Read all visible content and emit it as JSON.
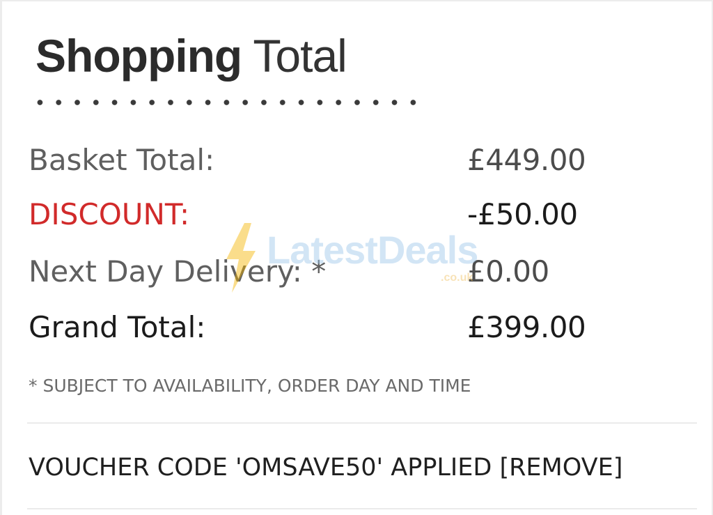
{
  "card": {
    "title_bold": "Shopping",
    "title_light": "Total"
  },
  "summary": {
    "rows": [
      {
        "label": "Basket Total:",
        "value": "£449.00"
      },
      {
        "label": "DISCOUNT:",
        "value": "-£50.00"
      },
      {
        "label": "Next Day Delivery: *",
        "value": "£0.00"
      },
      {
        "label": "Grand Total:",
        "value": "£399.00"
      }
    ]
  },
  "note": "* SUBJECT TO AVAILABILITY, ORDER DAY AND TIME",
  "voucher": {
    "text": "VOUCHER CODE 'OMSAVE50' APPLIED ",
    "remove_label": "[REMOVE]"
  },
  "watermark": {
    "text": "LatestDeals",
    "sub": ".co.uk"
  },
  "colors": {
    "discount_label": "#d12a2a",
    "text_dark": "#1b1b1b",
    "text_muted": "#5f5f5f",
    "watermark_blue": "#9cc6ea",
    "watermark_bolt": "#f5b400"
  }
}
